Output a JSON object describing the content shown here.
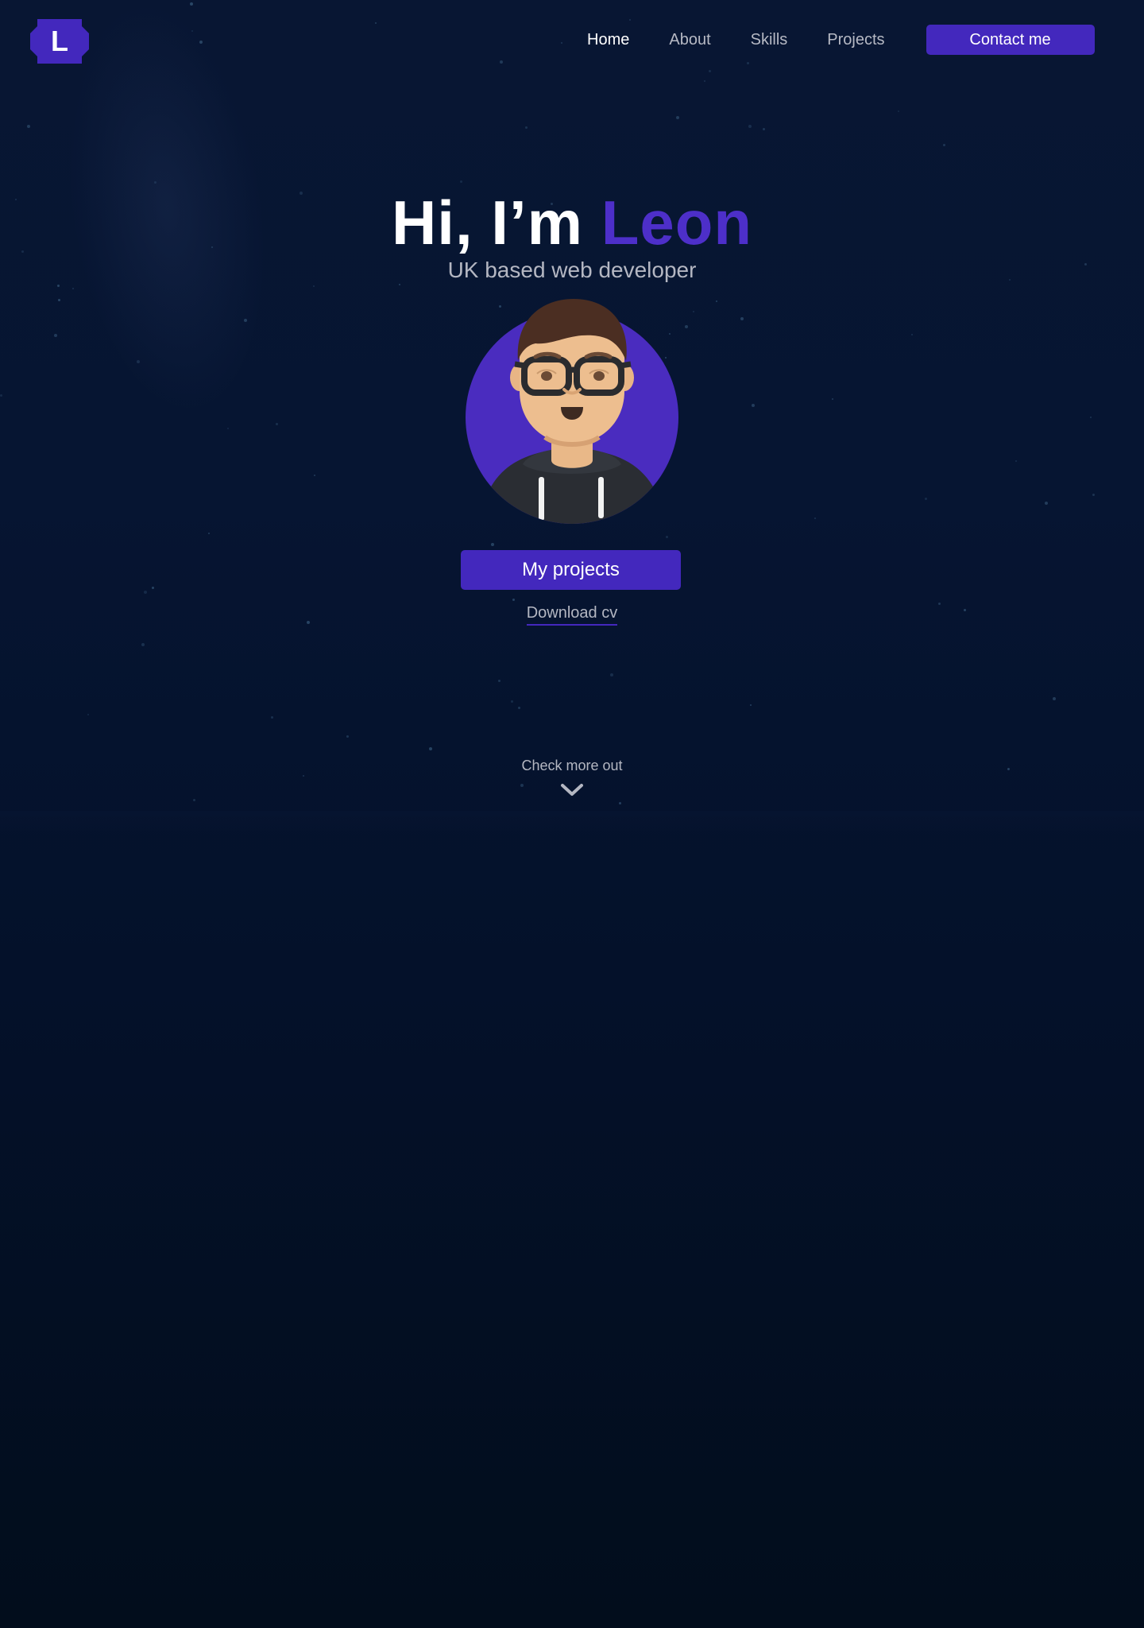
{
  "header": {
    "logo_letter": "L",
    "nav": [
      {
        "label": "Home",
        "active": true
      },
      {
        "label": "About",
        "active": false
      },
      {
        "label": "Skills",
        "active": false
      },
      {
        "label": "Projects",
        "active": false
      }
    ],
    "contact_label": "Contact me"
  },
  "hero": {
    "greeting": "Hi, I’m",
    "name": "Leon",
    "subtitle": "UK based web developer",
    "projects_button": "My projects",
    "download_cv": "Download cv",
    "check_more": "Check more out"
  },
  "icons": {
    "logo": "logo-badge-icon",
    "avatar": "avatar-illustration",
    "scroll": "chevron-down-icon"
  },
  "colors": {
    "accent": "#4328bd",
    "name_accent": "#4d2fc9",
    "background": "#061532",
    "muted_text": "#b4b7c2"
  }
}
